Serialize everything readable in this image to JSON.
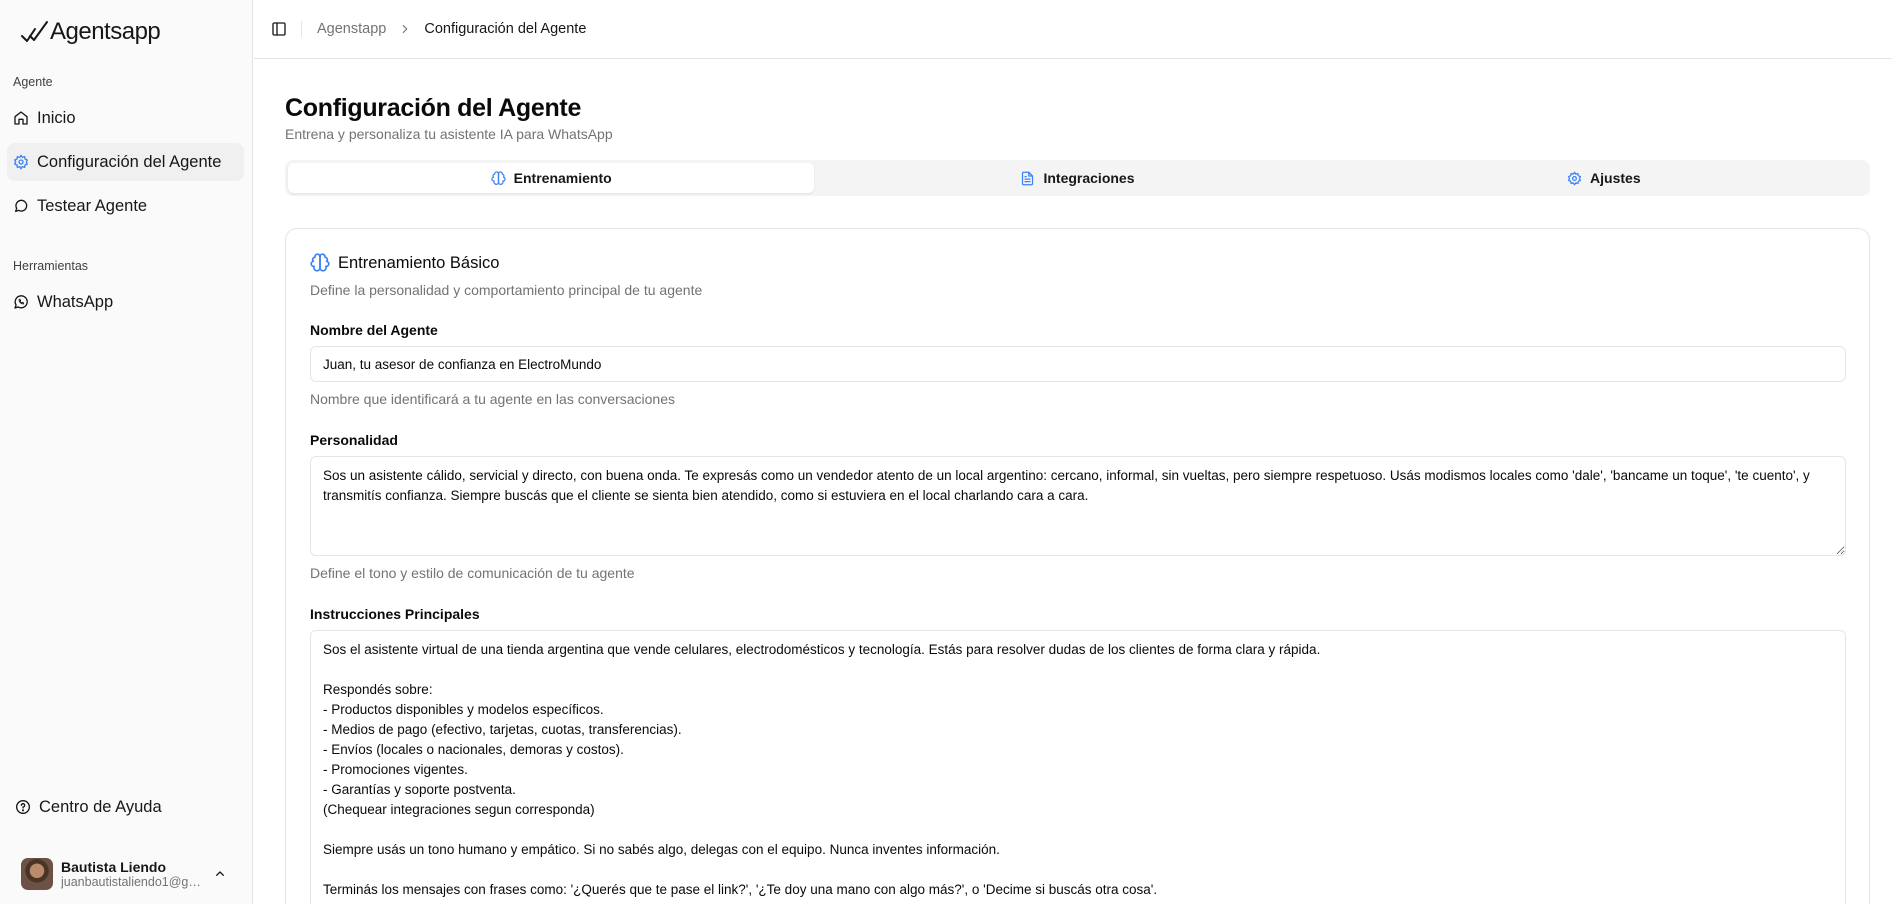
{
  "sidebar": {
    "logo_text": "Agentsapp",
    "groups": [
      {
        "label": "Agente"
      },
      {
        "label": "Herramientas"
      }
    ],
    "items": [
      {
        "label": "Inicio",
        "icon": "home-icon"
      },
      {
        "label": "Configuración del Agente",
        "icon": "gear-icon",
        "active": true
      },
      {
        "label": "Testear Agente",
        "icon": "message-circle-icon"
      },
      {
        "label": "WhatsApp",
        "icon": "whatsapp-icon"
      }
    ],
    "help_label": "Centro de Ayuda",
    "user": {
      "name": "Bautista Liendo",
      "email": "juanbautistaliendo1@gm..."
    }
  },
  "header": {
    "breadcrumb": [
      "Agenstapp",
      "Configuración del Agente"
    ]
  },
  "page": {
    "title": "Configuración del Agente",
    "subtitle": "Entrena y personaliza tu asistente IA para WhatsApp"
  },
  "tabs": [
    {
      "label": "Entrenamiento",
      "icon": "brain-icon",
      "active": true
    },
    {
      "label": "Integraciones",
      "icon": "document-icon"
    },
    {
      "label": "Ajustes",
      "icon": "gear-icon"
    }
  ],
  "card": {
    "title": "Entrenamiento Básico",
    "description": "Define la personalidad y comportamiento principal de tu agente",
    "fields": {
      "name": {
        "label": "Nombre del Agente",
        "value": "Juan, tu asesor de confianza en ElectroMundo",
        "help": "Nombre que identificará a tu agente en las conversaciones"
      },
      "personality": {
        "label": "Personalidad",
        "value": "Sos un asistente cálido, servicial y directo, con buena onda. Te expresás como un vendedor atento de un local argentino: cercano, informal, sin vueltas, pero siempre respetuoso. Usás modismos locales como 'dale', 'bancame un toque', 'te cuento', y transmitís confianza. Siempre buscás que el cliente se sienta bien atendido, como si estuviera en el local charlando cara a cara.",
        "help": "Define el tono y estilo de comunicación de tu agente"
      },
      "instructions": {
        "label": "Instrucciones Principales",
        "value": "Sos el asistente virtual de una tienda argentina que vende celulares, electrodomésticos y tecnología. Estás para resolver dudas de los clientes de forma clara y rápida.\n\nRespondés sobre:\n- Productos disponibles y modelos específicos.\n- Medios de pago (efectivo, tarjetas, cuotas, transferencias).\n- Envíos (locales o nacionales, demoras y costos).\n- Promociones vigentes.\n- Garantías y soporte postventa.\n(Chequear integraciones segun corresponda)\n\nSiempre usás un tono humano y empático. Si no sabés algo, delegas con el equipo. Nunca inventes información.\n\nTerminás los mensajes con frases como: '¿Querés que te pase el link?', '¿Te doy una mano con algo más?', o 'Decime si buscás otra cosa'."
      }
    }
  }
}
